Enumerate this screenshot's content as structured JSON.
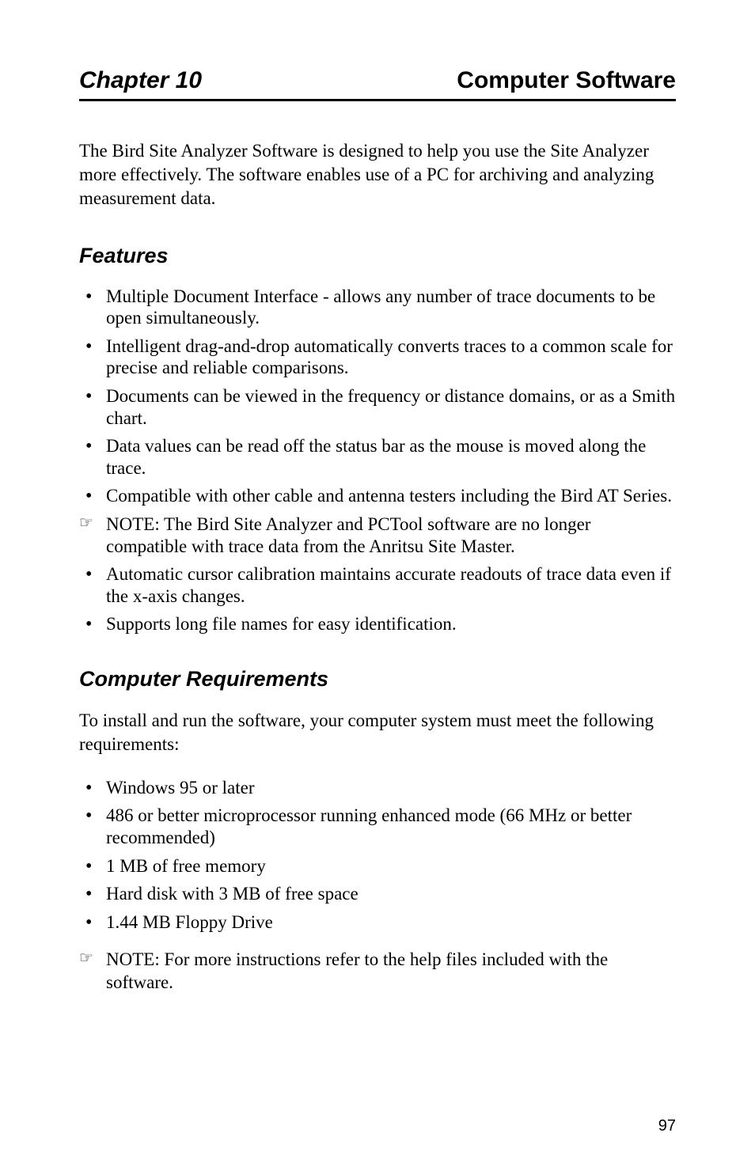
{
  "header": {
    "chapter_label": "Chapter 10",
    "chapter_title": "Computer Software"
  },
  "intro": "The Bird Site Analyzer Software is designed to help you use the Site Analyzer more effectively. The software enables use of a PC for archiving and analyzing measurement data.",
  "section1": {
    "heading": "Features",
    "items": [
      {
        "type": "bullet",
        "text": "Multiple Document Interface - allows any number of trace documents to be open simultaneously."
      },
      {
        "type": "bullet",
        "text": "Intelligent drag-and-drop automatically converts traces to a common scale for precise and reliable comparisons."
      },
      {
        "type": "bullet",
        "text": "Documents can be viewed in the frequency or distance domains, or as a Smith chart."
      },
      {
        "type": "bullet",
        "text": "Data values can be read off the status bar as the mouse is moved along the trace."
      },
      {
        "type": "bullet",
        "text": "Compatible with other cable and antenna testers including the Bird AT Series."
      },
      {
        "type": "note",
        "text": "NOTE: The Bird Site Analyzer and PCTool software are no longer compatible with trace data from the Anritsu Site Master."
      },
      {
        "type": "bullet",
        "text": "Automatic cursor calibration maintains accurate readouts of trace data even if the x-axis changes."
      },
      {
        "type": "bullet",
        "text": "Supports long file names for easy identification."
      }
    ]
  },
  "section2": {
    "heading": "Computer Requirements",
    "intro": "To install and run the software, your computer system must meet the following requirements:",
    "items": [
      {
        "type": "bullet",
        "text": "Windows 95 or later"
      },
      {
        "type": "bullet",
        "text": "486 or better microprocessor running enhanced mode (66 MHz or better recommended)"
      },
      {
        "type": "bullet",
        "text": "1 MB of free memory"
      },
      {
        "type": "bullet",
        "text": "Hard disk with 3 MB of free space"
      },
      {
        "type": "bullet",
        "text": "1.44 MB Floppy Drive"
      }
    ],
    "note": "NOTE: For more instructions refer to the help files included with the software."
  },
  "page_number": "97"
}
